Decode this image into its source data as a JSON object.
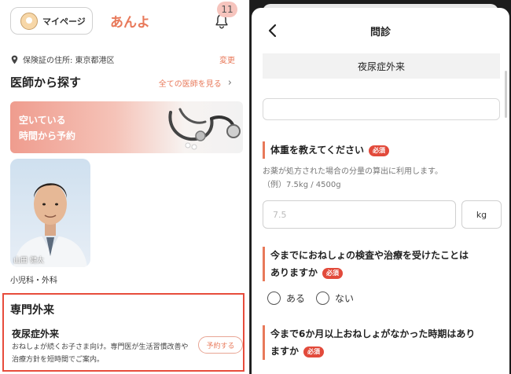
{
  "left": {
    "mypage_label": "マイページ",
    "brand": "あんよ",
    "notification_count": "11",
    "address": "保険証の住所: 東京都港区",
    "address_change": "変更",
    "doctors_title": "医師から探す",
    "see_all": "全ての医師を見る",
    "banner_line1": "空いている",
    "banner_line2": "時間から予約",
    "doctor_name": "山田 健太",
    "doctor_dept": "小児科・外科",
    "specialty_title": "専門外来",
    "clinic_name": "夜尿症外来",
    "clinic_desc": "おねしょが続くお子さま向け。専門医が生活習慣改善や治療方針を短時間でご案内。",
    "reserve_label": "予約する",
    "colors": {
      "accent": "#e8795a",
      "highlight_border": "#e74c3c"
    }
  },
  "right": {
    "title": "問診",
    "clinic_name": "夜尿症外来",
    "required_label": "必須",
    "q1": {
      "label": "体重を教えてください",
      "hint1": "お薬が処方された場合の分量の算出に利用します。",
      "hint2": "（例）7.5kg / 4500g",
      "placeholder": "7.5",
      "unit": "kg"
    },
    "q2": {
      "line1": "今までにおねしょの検査や治療を受けたことは",
      "line2": "ありますか",
      "option_yes": "ある",
      "option_no": "ない"
    },
    "q3": {
      "line1": "今まで6か月以上おねしょがなかった時期はあり",
      "line2": "ますか"
    }
  }
}
